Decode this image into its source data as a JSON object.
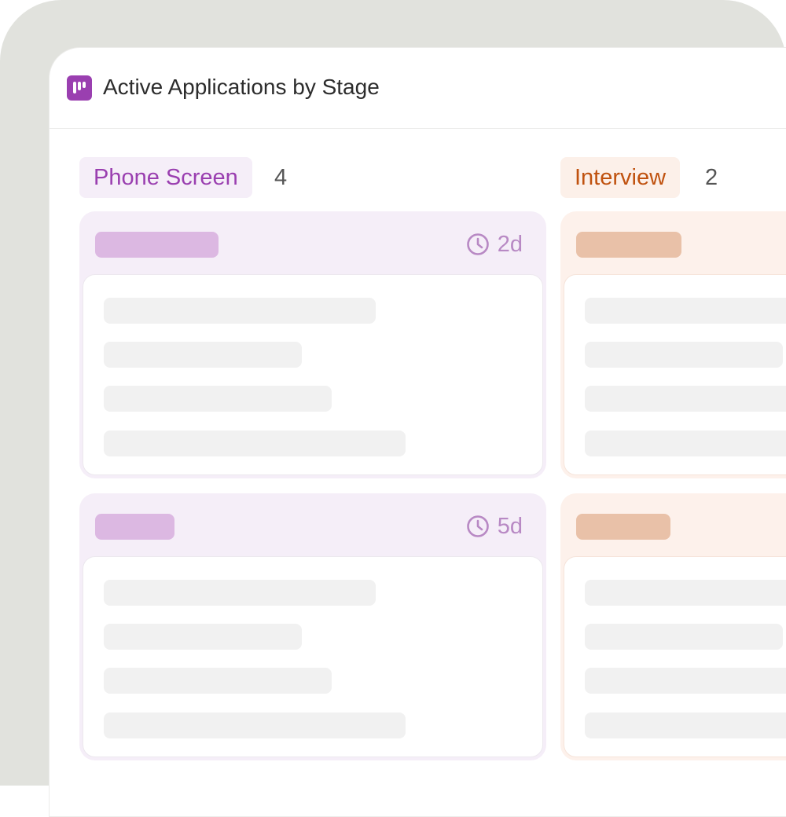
{
  "header": {
    "title": "Active Applications by Stage"
  },
  "columns": [
    {
      "label": "Phone Screen",
      "count": "4",
      "colors": {
        "label_bg": "#f5eef8",
        "label_text": "#9a3fb0",
        "card_bg": "#f5eef8",
        "tag": "#dcb8e2"
      },
      "cards": [
        {
          "age": "2d"
        },
        {
          "age": "5d"
        }
      ]
    },
    {
      "label": "Interview",
      "count": "2",
      "colors": {
        "label_bg": "#fcf0e9",
        "label_text": "#c0520f",
        "card_bg": "#fdf1eb",
        "tag": "#e9c1a8"
      },
      "cards": [
        {},
        {}
      ]
    }
  ]
}
